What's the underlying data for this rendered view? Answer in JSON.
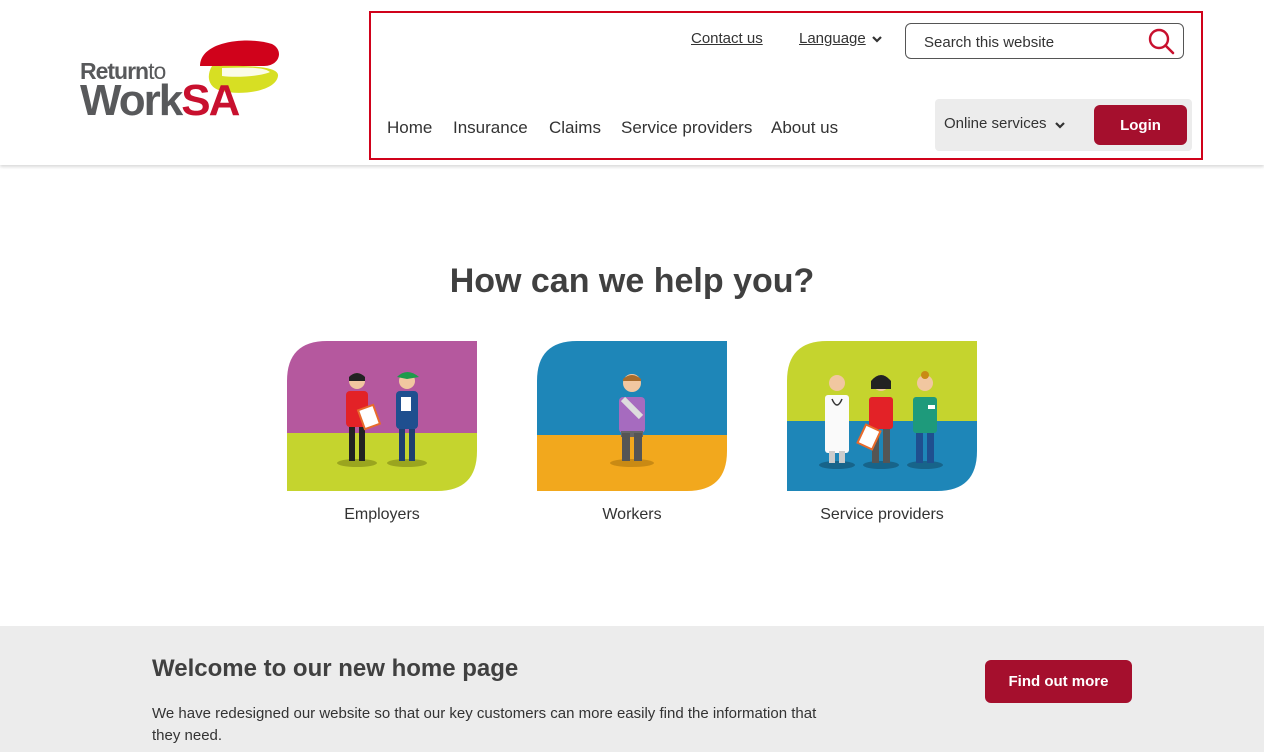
{
  "logo": {
    "line1_main": "Return",
    "line1_small": "to",
    "line2_main": "Work",
    "line2_accent": "SA"
  },
  "utility": {
    "contact_label": "Contact us",
    "language_label": "Language"
  },
  "search": {
    "placeholder": "Search this website",
    "icon": "search-icon"
  },
  "main_nav": {
    "items": [
      {
        "label": "Home"
      },
      {
        "label": "Insurance"
      },
      {
        "label": "Claims"
      },
      {
        "label": "Service providers"
      },
      {
        "label": "About us"
      }
    ]
  },
  "online_services": {
    "label": "Online services",
    "login_label": "Login"
  },
  "help": {
    "title": "How can we help you?",
    "cards": [
      {
        "label": "Employers",
        "top_color": "#b5589e",
        "bottom_color": "#c5d42e"
      },
      {
        "label": "Workers",
        "top_color": "#1e86b8",
        "bottom_color": "#f2a81d"
      },
      {
        "label": "Service providers",
        "top_color": "#c5d42e",
        "bottom_color": "#1e86b8"
      }
    ]
  },
  "banner": {
    "title": "Welcome to our new home page",
    "text": "We have redesigned our website so that our key customers can more easily find the information that they need.",
    "button_label": "Find out more"
  },
  "colors": {
    "brand_red": "#a50f2d",
    "highlight_red": "#d0021b",
    "logo_grey": "#58595b"
  }
}
